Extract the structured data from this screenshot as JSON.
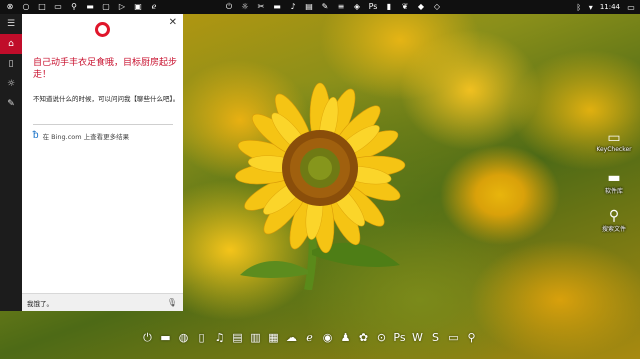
{
  "topbar": {
    "left_icons": [
      "close-circle-icon",
      "circle-icon",
      "square-icon",
      "file-explorer-icon",
      "search-icon",
      "taskview-icon",
      "monitor-icon",
      "play-icon",
      "app-icon",
      "edge-icon"
    ],
    "center_icons": [
      "power-icon",
      "brightness-icon",
      "cut-icon",
      "folder-icon",
      "music-icon",
      "film-icon",
      "paint-icon",
      "notes-icon",
      "app-icon",
      "ps-icon",
      "book-icon",
      "leaf-icon",
      "app-icon",
      "app-icon"
    ],
    "tray_icons": [
      "bluetooth-icon",
      "network-icon",
      "keyboard-icon"
    ],
    "clock": "11:44"
  },
  "rail": {
    "items": [
      "home-icon",
      "notebook-icon",
      "lightbulb-icon",
      "feedback-icon"
    ]
  },
  "cortana": {
    "greeting": "自己动手丰衣足食哦，目标厨房起步走！",
    "sub": "不知道说什么的时候，可以问问我【聊些什么吧】。",
    "bing_text": "在 Bing.com 上查看更多结果",
    "search_text": "我饿了。"
  },
  "desktop": {
    "icons": [
      {
        "name": "keychecker",
        "label": "KeyChecker",
        "glyph": "▭"
      },
      {
        "name": "folder",
        "label": "软件库",
        "glyph": "▬"
      },
      {
        "name": "search",
        "label": "搜索文件",
        "glyph": "⚲"
      }
    ]
  },
  "dock": {
    "icons": [
      "power-icon",
      "folder-icon",
      "globe-icon",
      "book-icon",
      "music-icon",
      "film-icon",
      "trash-icon",
      "chart-icon",
      "cloud-icon",
      "edge-icon",
      "wechat-icon",
      "qq-icon",
      "app-icon",
      "office-icon",
      "ps-icon",
      "word-icon",
      "store-icon",
      "monitor-icon",
      "search-icon"
    ]
  },
  "colors": {
    "accent": "#c00d2a",
    "cortana_ring": "#e0162b",
    "bing_blue": "#1a73c8"
  }
}
